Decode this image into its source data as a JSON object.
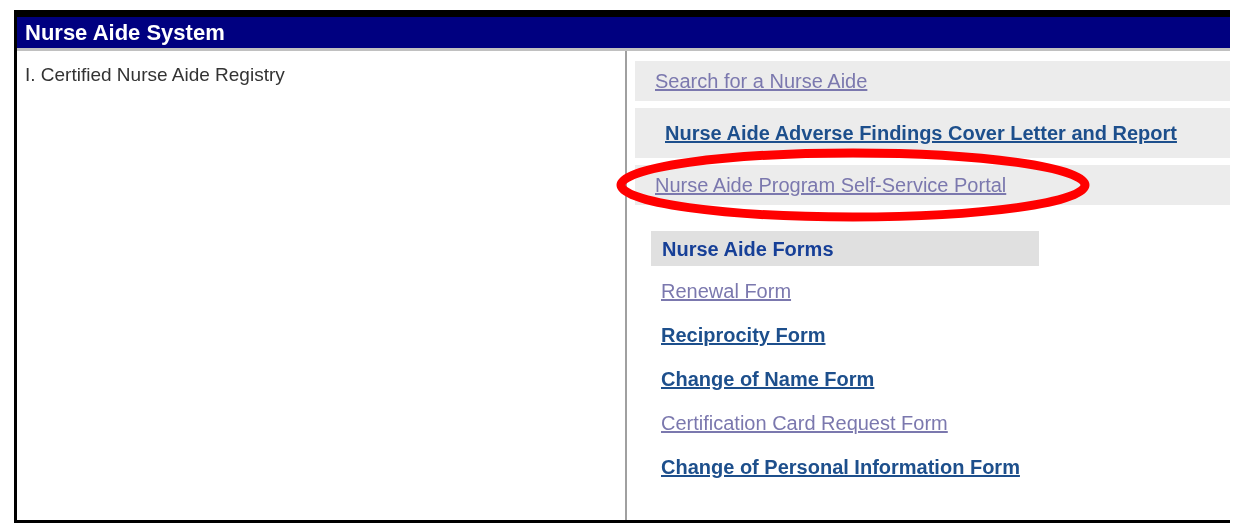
{
  "header": {
    "title": "Nurse Aide System"
  },
  "left": {
    "heading": "I. Certified Nurse Aide Registry"
  },
  "menu": [
    {
      "label": "Search for a Nurse Aide",
      "visited": true,
      "circled": false
    },
    {
      "label": "Nurse Aide Adverse Findings Cover Letter and Report",
      "visited": false,
      "circled": false
    },
    {
      "label": "Nurse Aide Program Self-Service Portal",
      "visited": true,
      "circled": true
    }
  ],
  "forms": {
    "heading": "Nurse Aide Forms",
    "links": [
      {
        "label": "Renewal Form",
        "visited": true
      },
      {
        "label": "Reciprocity Form",
        "visited": false
      },
      {
        "label": "Change of Name Form",
        "visited": false
      },
      {
        "label": "Certification Card Request Form",
        "visited": true
      },
      {
        "label": "Change of Personal Information Form",
        "visited": false
      }
    ]
  }
}
